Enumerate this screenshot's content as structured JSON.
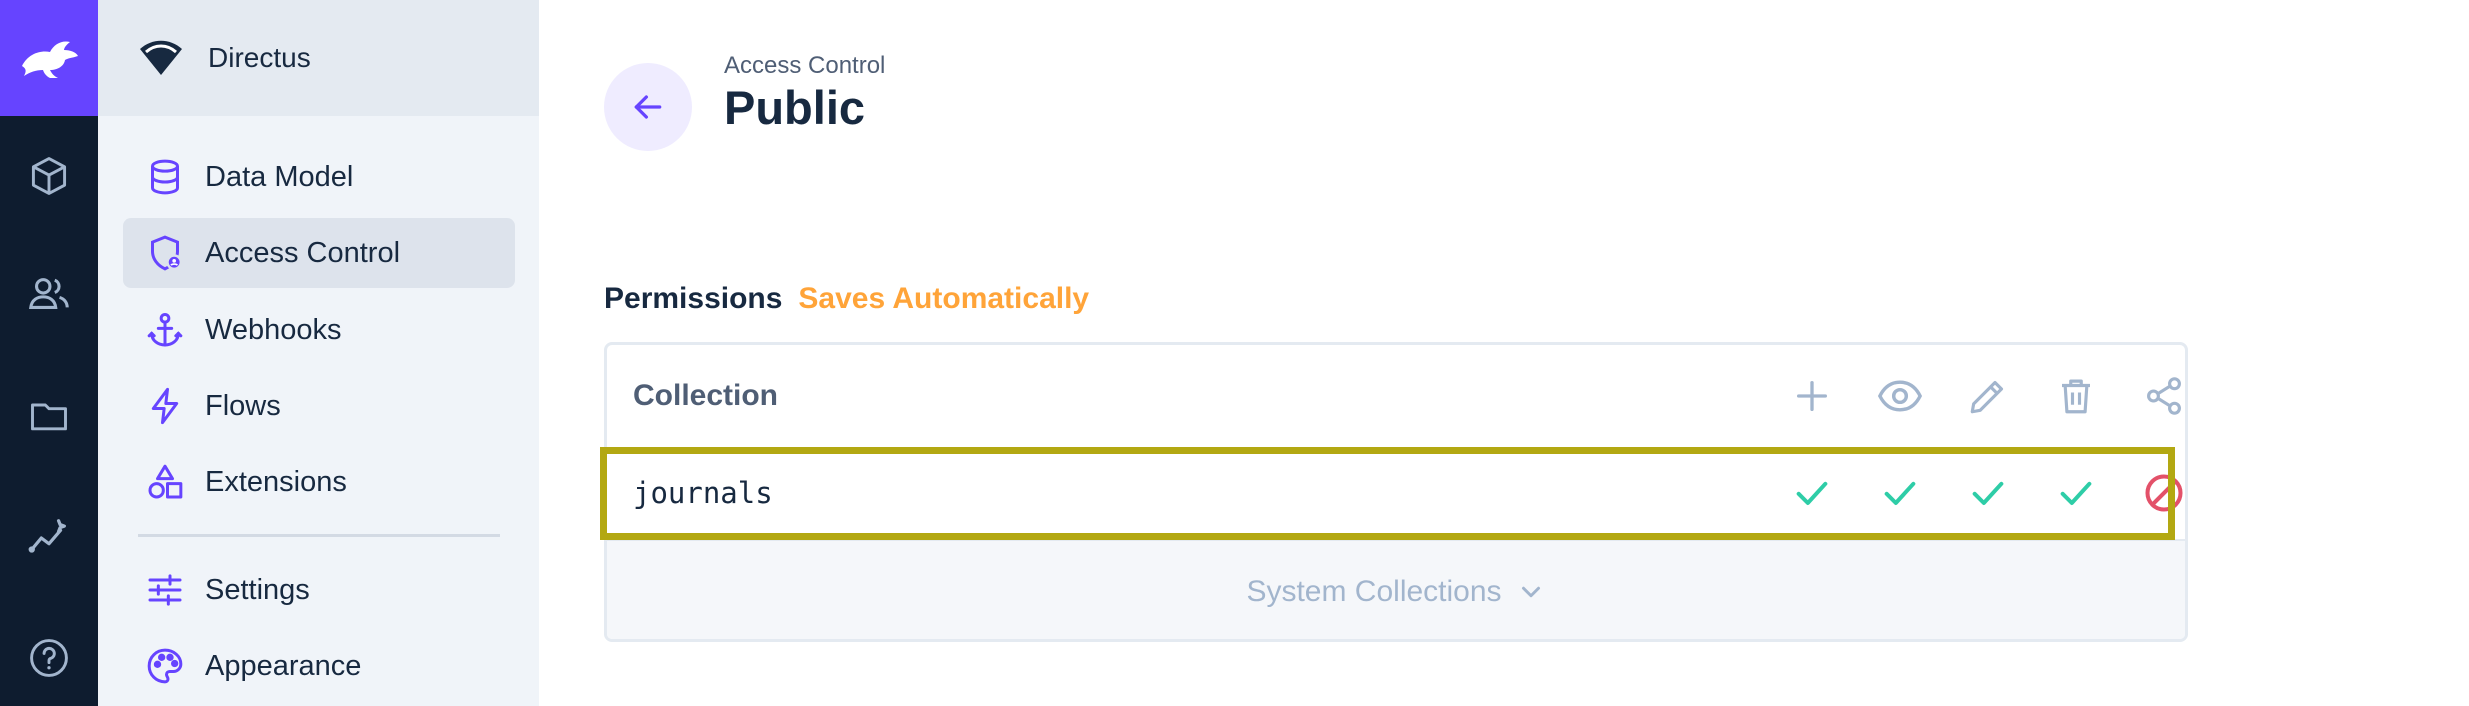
{
  "app": {
    "brand_icon": "rabbit-logo-icon",
    "accent": "#6644ff"
  },
  "module_bar": [
    {
      "name": "content",
      "icon": "box-icon"
    },
    {
      "name": "users",
      "icon": "people-icon"
    },
    {
      "name": "files",
      "icon": "folder-icon"
    },
    {
      "name": "insights",
      "icon": "insights-icon"
    },
    {
      "name": "help",
      "icon": "help-icon"
    }
  ],
  "project": {
    "name": "Directus",
    "icon": "wifi-logo-icon"
  },
  "nav": {
    "items": [
      {
        "label": "Data Model",
        "icon": "database-icon",
        "active": false
      },
      {
        "label": "Access Control",
        "icon": "shield-user-icon",
        "active": true
      },
      {
        "label": "Webhooks",
        "icon": "anchor-icon",
        "active": false
      },
      {
        "label": "Flows",
        "icon": "bolt-icon",
        "active": false
      },
      {
        "label": "Extensions",
        "icon": "shapes-icon",
        "active": false
      },
      {
        "label": "Settings",
        "icon": "sliders-icon",
        "active": false
      },
      {
        "label": "Appearance",
        "icon": "palette-icon",
        "active": false
      }
    ]
  },
  "header": {
    "breadcrumb": "Access Control",
    "title": "Public"
  },
  "permissions": {
    "title": "Permissions",
    "note": "Saves Automatically",
    "note_color": "#ffa439",
    "column_header": "Collection",
    "actions": [
      "create",
      "read",
      "update",
      "delete",
      "share"
    ],
    "rows": [
      {
        "collection": "journals",
        "create": "all",
        "read": "all",
        "update": "all",
        "delete": "all",
        "share": "none"
      }
    ],
    "footer": "System Collections"
  },
  "colors": {
    "allowed": "#2ecda7",
    "denied": "#e35169",
    "highlight": "#b3a812"
  }
}
